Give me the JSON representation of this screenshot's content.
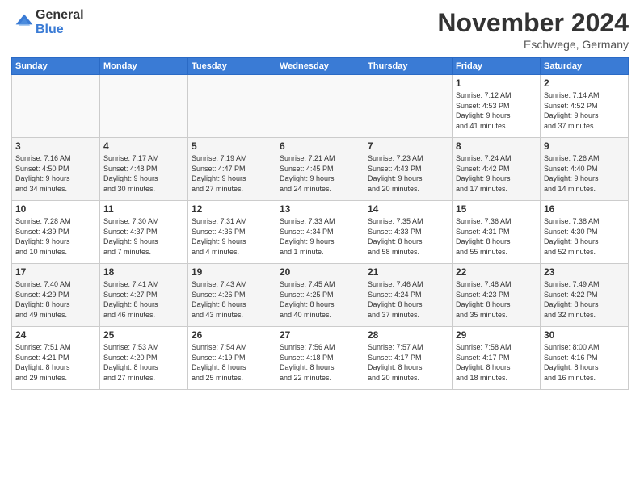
{
  "logo": {
    "general": "General",
    "blue": "Blue"
  },
  "header": {
    "month": "November 2024",
    "location": "Eschwege, Germany"
  },
  "days_of_week": [
    "Sunday",
    "Monday",
    "Tuesday",
    "Wednesday",
    "Thursday",
    "Friday",
    "Saturday"
  ],
  "weeks": [
    [
      {
        "day": "",
        "info": ""
      },
      {
        "day": "",
        "info": ""
      },
      {
        "day": "",
        "info": ""
      },
      {
        "day": "",
        "info": ""
      },
      {
        "day": "",
        "info": ""
      },
      {
        "day": "1",
        "info": "Sunrise: 7:12 AM\nSunset: 4:53 PM\nDaylight: 9 hours\nand 41 minutes."
      },
      {
        "day": "2",
        "info": "Sunrise: 7:14 AM\nSunset: 4:52 PM\nDaylight: 9 hours\nand 37 minutes."
      }
    ],
    [
      {
        "day": "3",
        "info": "Sunrise: 7:16 AM\nSunset: 4:50 PM\nDaylight: 9 hours\nand 34 minutes."
      },
      {
        "day": "4",
        "info": "Sunrise: 7:17 AM\nSunset: 4:48 PM\nDaylight: 9 hours\nand 30 minutes."
      },
      {
        "day": "5",
        "info": "Sunrise: 7:19 AM\nSunset: 4:47 PM\nDaylight: 9 hours\nand 27 minutes."
      },
      {
        "day": "6",
        "info": "Sunrise: 7:21 AM\nSunset: 4:45 PM\nDaylight: 9 hours\nand 24 minutes."
      },
      {
        "day": "7",
        "info": "Sunrise: 7:23 AM\nSunset: 4:43 PM\nDaylight: 9 hours\nand 20 minutes."
      },
      {
        "day": "8",
        "info": "Sunrise: 7:24 AM\nSunset: 4:42 PM\nDaylight: 9 hours\nand 17 minutes."
      },
      {
        "day": "9",
        "info": "Sunrise: 7:26 AM\nSunset: 4:40 PM\nDaylight: 9 hours\nand 14 minutes."
      }
    ],
    [
      {
        "day": "10",
        "info": "Sunrise: 7:28 AM\nSunset: 4:39 PM\nDaylight: 9 hours\nand 10 minutes."
      },
      {
        "day": "11",
        "info": "Sunrise: 7:30 AM\nSunset: 4:37 PM\nDaylight: 9 hours\nand 7 minutes."
      },
      {
        "day": "12",
        "info": "Sunrise: 7:31 AM\nSunset: 4:36 PM\nDaylight: 9 hours\nand 4 minutes."
      },
      {
        "day": "13",
        "info": "Sunrise: 7:33 AM\nSunset: 4:34 PM\nDaylight: 9 hours\nand 1 minute."
      },
      {
        "day": "14",
        "info": "Sunrise: 7:35 AM\nSunset: 4:33 PM\nDaylight: 8 hours\nand 58 minutes."
      },
      {
        "day": "15",
        "info": "Sunrise: 7:36 AM\nSunset: 4:31 PM\nDaylight: 8 hours\nand 55 minutes."
      },
      {
        "day": "16",
        "info": "Sunrise: 7:38 AM\nSunset: 4:30 PM\nDaylight: 8 hours\nand 52 minutes."
      }
    ],
    [
      {
        "day": "17",
        "info": "Sunrise: 7:40 AM\nSunset: 4:29 PM\nDaylight: 8 hours\nand 49 minutes."
      },
      {
        "day": "18",
        "info": "Sunrise: 7:41 AM\nSunset: 4:27 PM\nDaylight: 8 hours\nand 46 minutes."
      },
      {
        "day": "19",
        "info": "Sunrise: 7:43 AM\nSunset: 4:26 PM\nDaylight: 8 hours\nand 43 minutes."
      },
      {
        "day": "20",
        "info": "Sunrise: 7:45 AM\nSunset: 4:25 PM\nDaylight: 8 hours\nand 40 minutes."
      },
      {
        "day": "21",
        "info": "Sunrise: 7:46 AM\nSunset: 4:24 PM\nDaylight: 8 hours\nand 37 minutes."
      },
      {
        "day": "22",
        "info": "Sunrise: 7:48 AM\nSunset: 4:23 PM\nDaylight: 8 hours\nand 35 minutes."
      },
      {
        "day": "23",
        "info": "Sunrise: 7:49 AM\nSunset: 4:22 PM\nDaylight: 8 hours\nand 32 minutes."
      }
    ],
    [
      {
        "day": "24",
        "info": "Sunrise: 7:51 AM\nSunset: 4:21 PM\nDaylight: 8 hours\nand 29 minutes."
      },
      {
        "day": "25",
        "info": "Sunrise: 7:53 AM\nSunset: 4:20 PM\nDaylight: 8 hours\nand 27 minutes."
      },
      {
        "day": "26",
        "info": "Sunrise: 7:54 AM\nSunset: 4:19 PM\nDaylight: 8 hours\nand 25 minutes."
      },
      {
        "day": "27",
        "info": "Sunrise: 7:56 AM\nSunset: 4:18 PM\nDaylight: 8 hours\nand 22 minutes."
      },
      {
        "day": "28",
        "info": "Sunrise: 7:57 AM\nSunset: 4:17 PM\nDaylight: 8 hours\nand 20 minutes."
      },
      {
        "day": "29",
        "info": "Sunrise: 7:58 AM\nSunset: 4:17 PM\nDaylight: 8 hours\nand 18 minutes."
      },
      {
        "day": "30",
        "info": "Sunrise: 8:00 AM\nSunset: 4:16 PM\nDaylight: 8 hours\nand 16 minutes."
      }
    ]
  ]
}
